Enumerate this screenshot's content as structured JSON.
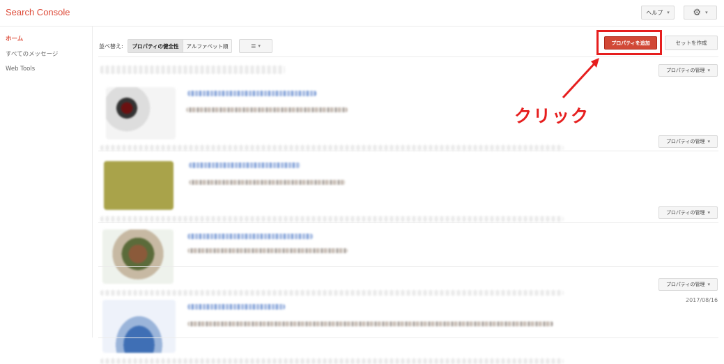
{
  "header": {
    "app_title": "Search Console",
    "help_label": "ヘルプ",
    "gear_caret": "▾",
    "help_caret": "▾"
  },
  "sidebar": {
    "items": [
      {
        "label": "ホーム",
        "active": true
      },
      {
        "label": "すべてのメッセージ",
        "active": false
      },
      {
        "label": "Web Tools",
        "active": false
      }
    ]
  },
  "toolbar": {
    "sort_label": "並べ替え:",
    "sort_options": [
      "プロパティの健全性",
      "アルファベット順"
    ],
    "add_property_label": "プロパティを追加",
    "create_set_label": "セットを作成"
  },
  "properties": [
    {
      "manage_label": "プロパティの管理"
    },
    {
      "manage_label": "プロパティの管理"
    },
    {
      "manage_label": "プロパティの管理"
    },
    {
      "manage_label": "プロパティの管理"
    }
  ],
  "last_date": "2017/08/16",
  "annotation": {
    "text": "クリック",
    "color": "#e61e1e"
  },
  "colors": {
    "accent": "#dd4b39",
    "add_button": "#d14836"
  }
}
